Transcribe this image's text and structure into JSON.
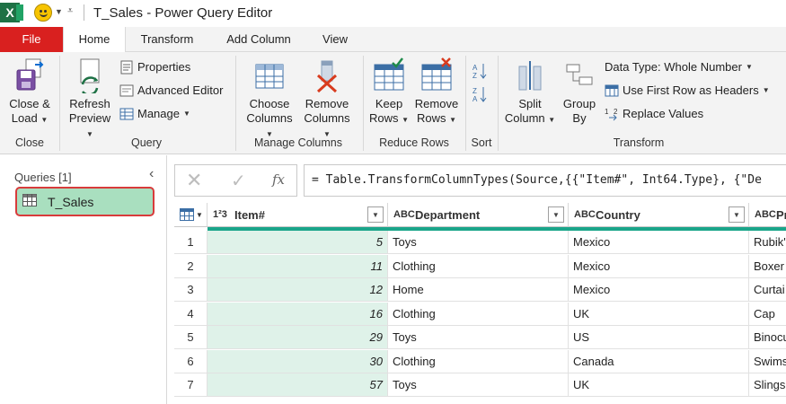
{
  "window": {
    "title": "T_Sales - Power Query Editor"
  },
  "tabs": [
    {
      "label": "File"
    },
    {
      "label": "Home"
    },
    {
      "label": "Transform"
    },
    {
      "label": "Add Column"
    },
    {
      "label": "View"
    }
  ],
  "ribbon": {
    "close": {
      "label_line1": "Close &",
      "label_line2": "Load",
      "group": "Close"
    },
    "query": {
      "group": "Query",
      "refresh_line1": "Refresh",
      "refresh_line2": "Preview",
      "properties": "Properties",
      "advanced_editor": "Advanced Editor",
      "manage": "Manage"
    },
    "manage_columns": {
      "group": "Manage Columns",
      "choose_line1": "Choose",
      "choose_line2": "Columns",
      "remove_line1": "Remove",
      "remove_line2": "Columns"
    },
    "reduce_rows": {
      "group": "Reduce Rows",
      "keep_line1": "Keep",
      "keep_line2": "Rows",
      "remove_line1": "Remove",
      "remove_line2": "Rows"
    },
    "sort": {
      "group": "Sort"
    },
    "transform": {
      "group": "Transform",
      "split_line1": "Split",
      "split_line2": "Column",
      "groupby_line1": "Group",
      "groupby_line2": "By",
      "data_type": "Data Type: Whole Number",
      "first_row_headers": "Use First Row as Headers",
      "replace_values": "Replace Values"
    }
  },
  "queries": {
    "title": "Queries [1]",
    "items": [
      {
        "name": "T_Sales"
      }
    ]
  },
  "formula": {
    "text": "= Table.TransformColumnTypes(Source,{{\"Item#\", Int64.Type}, {\"De"
  },
  "table": {
    "columns": [
      {
        "type": "1²3",
        "name": "Item#"
      },
      {
        "type": "ABC",
        "name": "Department"
      },
      {
        "type": "ABC",
        "name": "Country"
      },
      {
        "type": "ABC",
        "name": "Pr"
      }
    ],
    "rows": [
      {
        "n": "1",
        "item": "5",
        "dept": "Toys",
        "country": "Mexico",
        "product": "Rubik's"
      },
      {
        "n": "2",
        "item": "11",
        "dept": "Clothing",
        "country": "Mexico",
        "product": "Boxer"
      },
      {
        "n": "3",
        "item": "12",
        "dept": "Home",
        "country": "Mexico",
        "product": "Curtai"
      },
      {
        "n": "4",
        "item": "16",
        "dept": "Clothing",
        "country": "UK",
        "product": "Cap"
      },
      {
        "n": "5",
        "item": "29",
        "dept": "Toys",
        "country": "US",
        "product": "Binocu"
      },
      {
        "n": "6",
        "item": "30",
        "dept": "Clothing",
        "country": "Canada",
        "product": "Swims"
      },
      {
        "n": "7",
        "item": "57",
        "dept": "Toys",
        "country": "UK",
        "product": "Slingsh"
      }
    ]
  },
  "colors": {
    "file_tab": "#d9201f",
    "selected_query": "#a9dfbf",
    "highlight_border": "#d83b3b",
    "column_quality_bar": "#1aa58a",
    "numeric_column_bg": "#dff2e9"
  }
}
